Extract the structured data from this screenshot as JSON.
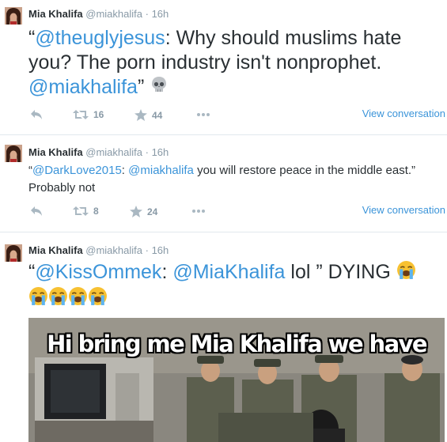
{
  "tweets": [
    {
      "name": "Mia Khalifa",
      "handle": "@miakhalifa",
      "dot": "·",
      "time": "16h",
      "quote_open": "“",
      "mention1": "@theuglyjesus",
      "body": ": Why should muslims hate you? The porn industry isn't nonprophet. ",
      "mention2": "@miakhalifa",
      "quote_close": "”",
      "retweets": "16",
      "favorites": "44",
      "view_conversation": "View conversation"
    },
    {
      "name": "Mia Khalifa",
      "handle": "@miakhalifa",
      "dot": "·",
      "time": "16h",
      "quote_open": "“",
      "mention1": "@DarkLove2015",
      "sep": ": ",
      "mention2": "@miakhalifa",
      "body": "  you will restore peace in the middle east.” Probably not",
      "retweets": "8",
      "favorites": "24",
      "view_conversation": "View conversation"
    },
    {
      "name": "Mia Khalifa",
      "handle": "@miakhalifa",
      "dot": "·",
      "time": "16h",
      "quote_open": "“",
      "mention1": "@KissOmmek",
      "sep": ": ",
      "mention2": "@MiaKhalifa",
      "body": " lol ” DYING ",
      "image_caption": "Hi bring me Mia Khalifa we have"
    }
  ],
  "icons": {
    "reply": "reply-icon",
    "retweet": "retweet-icon",
    "favorite": "star-icon",
    "more": "more-icon",
    "skull": "skull-emoji",
    "crying": "loudly-crying-face-emoji"
  },
  "colors": {
    "link": "#3b94d9",
    "muted": "#8899a6",
    "action": "#aab8c2",
    "text": "#292f33"
  }
}
